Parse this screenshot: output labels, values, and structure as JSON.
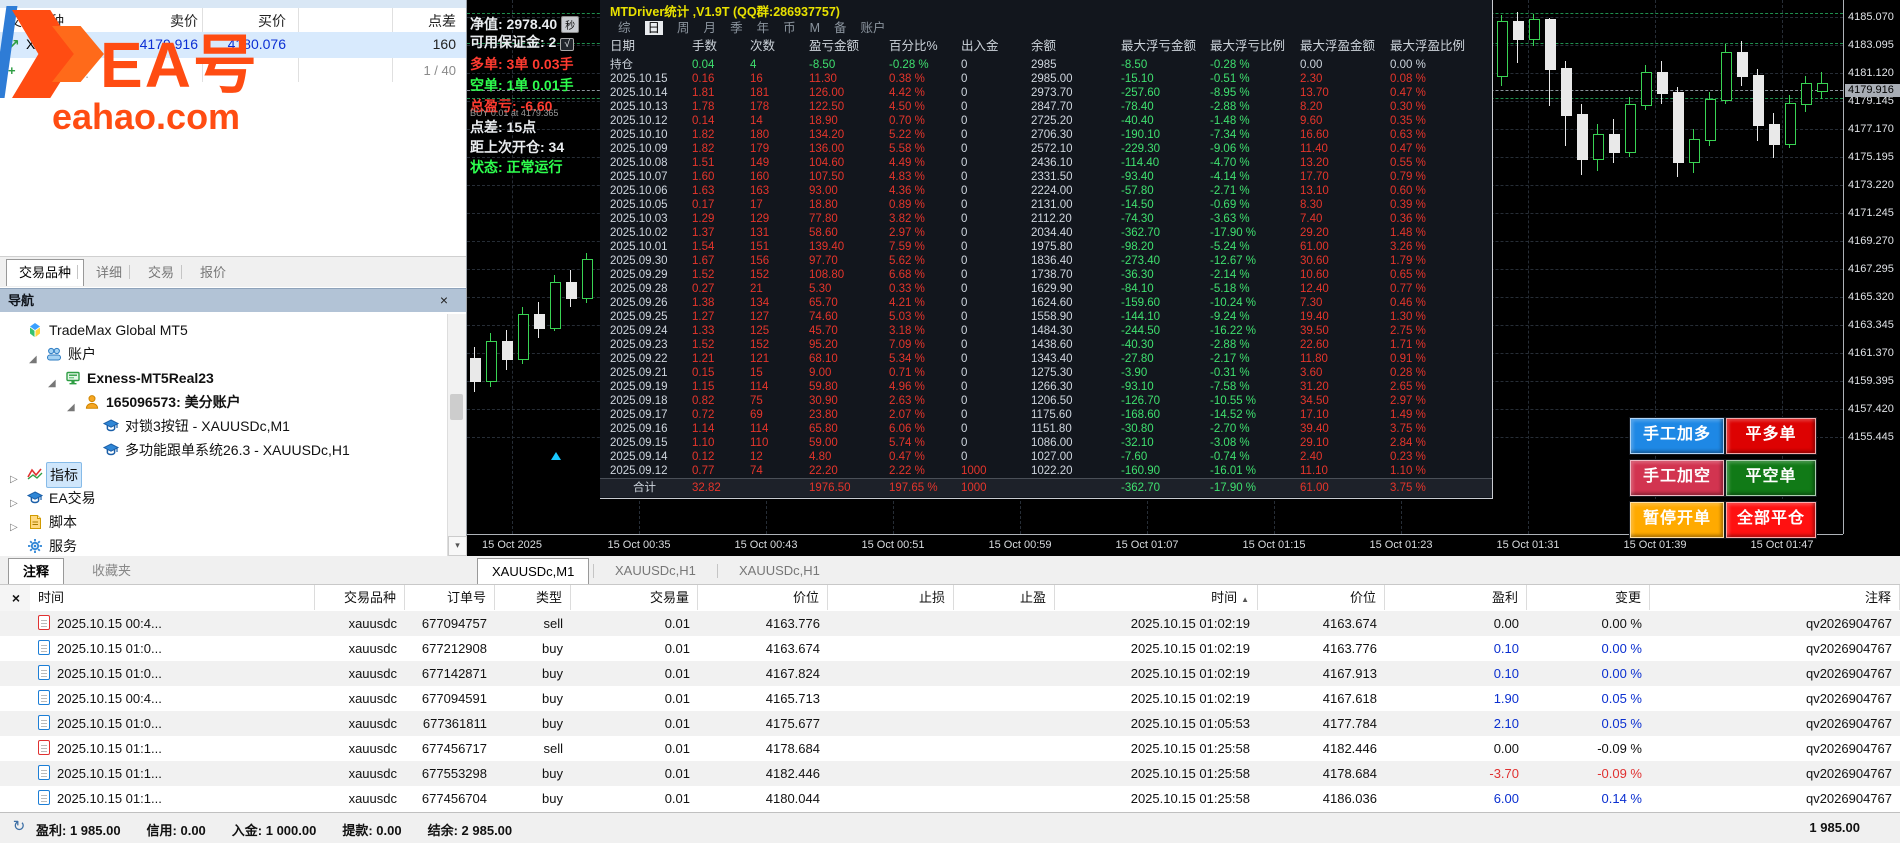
{
  "market_watch": {
    "columns": [
      "交易品种",
      "卖价",
      "买价",
      "点差"
    ],
    "row": {
      "symbol": "XAUUSDc",
      "bid": "4179.916",
      "ask": "4180.076",
      "spread": "160"
    },
    "add_label": "点击添加...",
    "pager": "1 / 40",
    "panel_tabs": [
      "交易品种",
      "详细",
      "交易",
      "报价"
    ],
    "active_panel_tab": "交易品种"
  },
  "watermark": {
    "brand": "EA号",
    "site": "eahao.com",
    "color": "#ff4c12"
  },
  "navigator": {
    "title": "导航",
    "close_glyph": "×",
    "items": [
      {
        "label": "TradeMax Global MT5",
        "icon": "broker-logo-icon",
        "indent": 0,
        "state": "none",
        "bold": false,
        "selected": false
      },
      {
        "label": "账户",
        "icon": "accounts-icon",
        "indent": 1,
        "state": "open",
        "bold": false,
        "selected": false
      },
      {
        "label": "Exness-MT5Real23",
        "icon": "server-icon",
        "indent": 2,
        "state": "open",
        "bold": true,
        "selected": false
      },
      {
        "label": "165096573: 美分账户",
        "icon": "person-icon",
        "indent": 3,
        "state": "open",
        "bold": true,
        "selected": false
      },
      {
        "label": "对锁3按钮 - XAUUSDc,M1",
        "icon": "ea-cap-icon",
        "indent": 4,
        "state": "none",
        "bold": false,
        "selected": false
      },
      {
        "label": "多功能跟单系统26.3 - XAUUSDc,H1",
        "icon": "ea-cap-icon",
        "indent": 4,
        "state": "none",
        "bold": false,
        "selected": false
      },
      {
        "label": "指标",
        "icon": "indicator-icon",
        "indent": 0,
        "state": "closed",
        "bold": false,
        "selected": true
      },
      {
        "label": "EA交易",
        "icon": "ea-cap-icon",
        "indent": 0,
        "state": "closed",
        "bold": false,
        "selected": false
      },
      {
        "label": "脚本",
        "icon": "script-icon",
        "indent": 0,
        "state": "closed",
        "bold": false,
        "selected": false
      },
      {
        "label": "服务",
        "icon": "service-gear-icon",
        "indent": 0,
        "state": "none",
        "bold": false,
        "selected": false
      }
    ],
    "bottom_tabs": [
      "注释",
      "收藏夹"
    ],
    "active_bottom_tab": "注释"
  },
  "chart_info": {
    "lines": [
      {
        "text": "净值: 2978.40",
        "color": "white",
        "badge": "秒",
        "small": false
      },
      {
        "text": "可用保证金: 2",
        "color": "white",
        "badge": "√",
        "small": false
      },
      {
        "text": "多单: 3单 0.03手",
        "color": "red",
        "badge": "",
        "small": false
      },
      {
        "text": "空单: 1单 0.01手",
        "color": "green",
        "badge": "",
        "small": false
      },
      {
        "text": "总盈亏: -6.60",
        "color": "red",
        "badge": "",
        "small": false
      },
      {
        "text": "BUY 0.01 at 4179.365",
        "color": "gray",
        "badge": "",
        "small": true
      },
      {
        "text": "点差: 15点",
        "color": "white",
        "badge": "",
        "small": false
      },
      {
        "text": "距上次开仓: 34",
        "color": "white",
        "badge": "",
        "small": false
      },
      {
        "text": "状态: 正常运行",
        "color": "green",
        "badge": "",
        "small": false
      }
    ]
  },
  "stats_panel": {
    "title": "MTDriver统计 ,V1.9T (QQ群:286937757)",
    "menu": [
      "综",
      "日",
      "周",
      "月",
      "季",
      "年",
      "币",
      "M",
      "备",
      "账户"
    ],
    "active_menu": "日",
    "columns": [
      "日期",
      "手数",
      "次数",
      "盈亏金额",
      "百分比%",
      "出入金",
      "余额",
      "最大浮亏金额",
      "最大浮亏比例",
      "最大浮盈金额",
      "最大浮盈比例"
    ],
    "open_row": [
      "持仓",
      "0.04",
      "4",
      "-8.50",
      "-0.28 %",
      "0",
      "2985",
      "-8.50",
      "-0.28 %",
      "0.00",
      "0.00 %"
    ],
    "rows": [
      [
        "2025.10.15",
        "0.16",
        "16",
        "11.30",
        "0.38 %",
        "0",
        "2985.00",
        "-15.10",
        "-0.51 %",
        "2.30",
        "0.08 %"
      ],
      [
        "2025.10.14",
        "1.81",
        "181",
        "126.00",
        "4.42 %",
        "0",
        "2973.70",
        "-257.60",
        "-8.95 %",
        "13.70",
        "0.47 %"
      ],
      [
        "2025.10.13",
        "1.78",
        "178",
        "122.50",
        "4.50 %",
        "0",
        "2847.70",
        "-78.40",
        "-2.88 %",
        "8.20",
        "0.30 %"
      ],
      [
        "2025.10.12",
        "0.14",
        "14",
        "18.90",
        "0.70 %",
        "0",
        "2725.20",
        "-40.40",
        "-1.48 %",
        "9.60",
        "0.35 %"
      ],
      [
        "2025.10.10",
        "1.82",
        "180",
        "134.20",
        "5.22 %",
        "0",
        "2706.30",
        "-190.10",
        "-7.34 %",
        "16.60",
        "0.63 %"
      ],
      [
        "2025.10.09",
        "1.82",
        "179",
        "136.00",
        "5.58 %",
        "0",
        "2572.10",
        "-229.30",
        "-9.06 %",
        "11.40",
        "0.47 %"
      ],
      [
        "2025.10.08",
        "1.51",
        "149",
        "104.60",
        "4.49 %",
        "0",
        "2436.10",
        "-114.40",
        "-4.70 %",
        "13.20",
        "0.55 %"
      ],
      [
        "2025.10.07",
        "1.60",
        "160",
        "107.50",
        "4.83 %",
        "0",
        "2331.50",
        "-93.40",
        "-4.14 %",
        "17.70",
        "0.79 %"
      ],
      [
        "2025.10.06",
        "1.63",
        "163",
        "93.00",
        "4.36 %",
        "0",
        "2224.00",
        "-57.80",
        "-2.71 %",
        "13.10",
        "0.60 %"
      ],
      [
        "2025.10.05",
        "0.17",
        "17",
        "18.80",
        "0.89 %",
        "0",
        "2131.00",
        "-14.50",
        "-0.69 %",
        "8.30",
        "0.39 %"
      ],
      [
        "2025.10.03",
        "1.29",
        "129",
        "77.80",
        "3.82 %",
        "0",
        "2112.20",
        "-74.30",
        "-3.63 %",
        "7.40",
        "0.36 %"
      ],
      [
        "2025.10.02",
        "1.37",
        "131",
        "58.60",
        "2.97 %",
        "0",
        "2034.40",
        "-362.70",
        "-17.90 %",
        "29.20",
        "1.48 %"
      ],
      [
        "2025.10.01",
        "1.54",
        "151",
        "139.40",
        "7.59 %",
        "0",
        "1975.80",
        "-98.20",
        "-5.24 %",
        "61.00",
        "3.26 %"
      ],
      [
        "2025.09.30",
        "1.67",
        "156",
        "97.70",
        "5.62 %",
        "0",
        "1836.40",
        "-273.40",
        "-12.67 %",
        "30.60",
        "1.79 %"
      ],
      [
        "2025.09.29",
        "1.52",
        "152",
        "108.80",
        "6.68 %",
        "0",
        "1738.70",
        "-36.30",
        "-2.14 %",
        "10.60",
        "0.65 %"
      ],
      [
        "2025.09.28",
        "0.27",
        "21",
        "5.30",
        "0.33 %",
        "0",
        "1629.90",
        "-84.10",
        "-5.18 %",
        "12.40",
        "0.77 %"
      ],
      [
        "2025.09.26",
        "1.38",
        "134",
        "65.70",
        "4.21 %",
        "0",
        "1624.60",
        "-159.60",
        "-10.24 %",
        "7.30",
        "0.46 %"
      ],
      [
        "2025.09.25",
        "1.27",
        "127",
        "74.60",
        "5.03 %",
        "0",
        "1558.90",
        "-144.10",
        "-9.24 %",
        "19.40",
        "1.30 %"
      ],
      [
        "2025.09.24",
        "1.33",
        "125",
        "45.70",
        "3.18 %",
        "0",
        "1484.30",
        "-244.50",
        "-16.22 %",
        "39.50",
        "2.75 %"
      ],
      [
        "2025.09.23",
        "1.52",
        "152",
        "95.20",
        "7.09 %",
        "0",
        "1438.60",
        "-40.30",
        "-2.88 %",
        "22.60",
        "1.71 %"
      ],
      [
        "2025.09.22",
        "1.21",
        "121",
        "68.10",
        "5.34 %",
        "0",
        "1343.40",
        "-27.80",
        "-2.17 %",
        "11.80",
        "0.91 %"
      ],
      [
        "2025.09.21",
        "0.15",
        "15",
        "9.00",
        "0.71 %",
        "0",
        "1275.30",
        "-3.90",
        "-0.31 %",
        "3.60",
        "0.28 %"
      ],
      [
        "2025.09.19",
        "1.15",
        "114",
        "59.80",
        "4.96 %",
        "0",
        "1266.30",
        "-93.10",
        "-7.58 %",
        "31.20",
        "2.65 %"
      ],
      [
        "2025.09.18",
        "0.82",
        "75",
        "30.90",
        "2.63 %",
        "0",
        "1206.50",
        "-126.70",
        "-10.55 %",
        "34.50",
        "2.97 %"
      ],
      [
        "2025.09.17",
        "0.72",
        "69",
        "23.80",
        "2.07 %",
        "0",
        "1175.60",
        "-168.60",
        "-14.52 %",
        "17.10",
        "1.49 %"
      ],
      [
        "2025.09.16",
        "1.14",
        "114",
        "65.80",
        "6.06 %",
        "0",
        "1151.80",
        "-30.80",
        "-2.70 %",
        "39.40",
        "3.75 %"
      ],
      [
        "2025.09.15",
        "1.10",
        "110",
        "59.00",
        "5.74 %",
        "0",
        "1086.00",
        "-32.10",
        "-3.08 %",
        "29.10",
        "2.84 %"
      ],
      [
        "2025.09.14",
        "0.12",
        "12",
        "4.80",
        "0.47 %",
        "0",
        "1027.00",
        "-7.60",
        "-0.74 %",
        "2.40",
        "0.23 %"
      ],
      [
        "2025.09.12",
        "0.77",
        "74",
        "22.20",
        "2.22 %",
        "1000",
        "1022.20",
        "-160.90",
        "-16.01 %",
        "11.10",
        "1.10 %"
      ]
    ],
    "total_row": [
      "合计",
      "32.82",
      "",
      "1976.50",
      "197.65 %",
      "1000",
      "",
      "-362.70",
      "-17.90 %",
      "61.00",
      "3.75 %"
    ]
  },
  "chart": {
    "price_ticks": [
      "4185.070",
      "4183.095",
      "4181.120",
      "4179.145",
      "4177.170",
      "4175.195",
      "4173.220",
      "4171.245",
      "4169.270",
      "4167.295",
      "4165.320",
      "4163.345",
      "4161.370",
      "4159.395",
      "4157.420",
      "4155.445"
    ],
    "current_price": "4179.916",
    "time_ticks": [
      "15 Oct 2025",
      "15 Oct 00:35",
      "15 Oct 00:43",
      "15 Oct 00:51",
      "15 Oct 00:59",
      "15 Oct 01:07",
      "15 Oct 01:15",
      "15 Oct 01:23",
      "15 Oct 01:31",
      "15 Oct 01:39",
      "15 Oct 01:47"
    ],
    "tabs": [
      "XAUUSDc,M1",
      "XAUUSDc,H1",
      "XAUUSDc,H1"
    ],
    "active_tab_index": 0,
    "candles_right": [
      [
        1497,
        4181.0,
        4184.8,
        4185.2,
        4180.2,
        1
      ],
      [
        1513,
        4184.8,
        4183.6,
        4185.4,
        4181.8,
        0
      ],
      [
        1529,
        4183.6,
        4184.9,
        4185.3,
        4183.0,
        1
      ],
      [
        1545,
        4184.9,
        4181.5,
        4185.0,
        4178.8,
        0
      ],
      [
        1561,
        4181.5,
        4178.2,
        4182.0,
        4176.0,
        0
      ],
      [
        1577,
        4178.2,
        4175.1,
        4178.9,
        4173.9,
        0
      ],
      [
        1593,
        4175.1,
        4176.8,
        4177.5,
        4174.2,
        1
      ],
      [
        1609,
        4176.8,
        4175.6,
        4177.9,
        4174.8,
        0
      ],
      [
        1625,
        4175.6,
        4178.9,
        4179.4,
        4175.2,
        1
      ],
      [
        1641,
        4178.9,
        4181.2,
        4181.7,
        4178.5,
        1
      ],
      [
        1657,
        4181.2,
        4179.8,
        4182.0,
        4178.9,
        0
      ],
      [
        1673,
        4179.8,
        4174.9,
        4180.1,
        4173.8,
        0
      ],
      [
        1689,
        4174.9,
        4176.5,
        4177.2,
        4174.1,
        1
      ],
      [
        1705,
        4176.5,
        4179.3,
        4179.8,
        4176.0,
        1
      ],
      [
        1721,
        4179.3,
        4182.6,
        4183.2,
        4178.9,
        1
      ],
      [
        1737,
        4182.6,
        4181.0,
        4183.4,
        4180.2,
        0
      ],
      [
        1753,
        4181.0,
        4177.5,
        4181.4,
        4176.3,
        0
      ],
      [
        1769,
        4177.5,
        4176.2,
        4178.3,
        4175.1,
        0
      ],
      [
        1785,
        4176.2,
        4179.0,
        4179.6,
        4175.8,
        1
      ],
      [
        1801,
        4179.0,
        4180.4,
        4180.9,
        4178.4,
        1
      ],
      [
        1817,
        4180.4,
        4179.9,
        4181.2,
        4179.3,
        1
      ]
    ],
    "candles_left": [
      [
        470,
        4161.0,
        4159.5,
        4161.8,
        4158.6,
        0
      ],
      [
        486,
        4159.5,
        4162.2,
        4162.8,
        4159.0,
        1
      ],
      [
        502,
        4162.2,
        4161.0,
        4163.0,
        4160.2,
        0
      ],
      [
        518,
        4161.0,
        4164.1,
        4164.6,
        4160.6,
        1
      ],
      [
        534,
        4164.1,
        4163.2,
        4165.0,
        4162.4,
        0
      ],
      [
        550,
        4163.2,
        4166.4,
        4166.9,
        4162.9,
        1
      ],
      [
        566,
        4166.4,
        4165.3,
        4167.2,
        4164.6,
        0
      ],
      [
        582,
        4165.3,
        4168.0,
        4168.4,
        4164.9,
        1
      ]
    ]
  },
  "trade_buttons": [
    {
      "label": "手工加多",
      "bg": "#1e88e5"
    },
    {
      "label": "平多单",
      "bg": "#dd0202"
    },
    {
      "label": "手工加空",
      "bg": "#d23450"
    },
    {
      "label": "平空单",
      "bg": "#117a17"
    },
    {
      "label": "暂停开单",
      "bg": "#ffaa00"
    },
    {
      "label": "全部平仓",
      "bg": "#ff1111"
    }
  ],
  "orders": {
    "columns": [
      "时间",
      "交易品种",
      "订单号",
      "类型",
      "交易量",
      "价位",
      "止损",
      "止盈",
      "时间",
      "价位",
      "盈利",
      "变更",
      "注释"
    ],
    "sorted_column_index": 8,
    "rows": [
      {
        "open_time": "2025.10.15 00:4...",
        "symbol": "xauusdc",
        "order": "677094757",
        "type": "sell",
        "volume": "0.01",
        "price": "4163.776",
        "sl": "",
        "tp": "",
        "close_time": "2025.10.15 01:02:19",
        "close_price": "4163.674",
        "profit": "0.00",
        "profit_color": "black",
        "change": "0.00 %",
        "change_color": "black",
        "comment": "qv2026904767"
      },
      {
        "open_time": "2025.10.15 01:0...",
        "symbol": "xauusdc",
        "order": "677212908",
        "type": "buy",
        "volume": "0.01",
        "price": "4163.674",
        "sl": "",
        "tp": "",
        "close_time": "2025.10.15 01:02:19",
        "close_price": "4163.776",
        "profit": "0.10",
        "profit_color": "blue",
        "change": "0.00 %",
        "change_color": "blue",
        "comment": "qv2026904767"
      },
      {
        "open_time": "2025.10.15 01:0...",
        "symbol": "xauusdc",
        "order": "677142871",
        "type": "buy",
        "volume": "0.01",
        "price": "4167.824",
        "sl": "",
        "tp": "",
        "close_time": "2025.10.15 01:02:19",
        "close_price": "4167.913",
        "profit": "0.10",
        "profit_color": "blue",
        "change": "0.00 %",
        "change_color": "blue",
        "comment": "qv2026904767"
      },
      {
        "open_time": "2025.10.15 00:4...",
        "symbol": "xauusdc",
        "order": "677094591",
        "type": "buy",
        "volume": "0.01",
        "price": "4165.713",
        "sl": "",
        "tp": "",
        "close_time": "2025.10.15 01:02:19",
        "close_price": "4167.618",
        "profit": "1.90",
        "profit_color": "blue",
        "change": "0.05 %",
        "change_color": "blue",
        "comment": "qv2026904767"
      },
      {
        "open_time": "2025.10.15 01:0...",
        "symbol": "xauusdc",
        "order": "677361811",
        "type": "buy",
        "volume": "0.01",
        "price": "4175.677",
        "sl": "",
        "tp": "",
        "close_time": "2025.10.15 01:05:53",
        "close_price": "4177.784",
        "profit": "2.10",
        "profit_color": "blue",
        "change": "0.05 %",
        "change_color": "blue",
        "comment": "qv2026904767"
      },
      {
        "open_time": "2025.10.15 01:1...",
        "symbol": "xauusdc",
        "order": "677456717",
        "type": "sell",
        "volume": "0.01",
        "price": "4178.684",
        "sl": "",
        "tp": "",
        "close_time": "2025.10.15 01:25:58",
        "close_price": "4182.446",
        "profit": "0.00",
        "profit_color": "black",
        "change": "-0.09 %",
        "change_color": "black",
        "comment": "qv2026904767"
      },
      {
        "open_time": "2025.10.15 01:1...",
        "symbol": "xauusdc",
        "order": "677553298",
        "type": "buy",
        "volume": "0.01",
        "price": "4182.446",
        "sl": "",
        "tp": "",
        "close_time": "2025.10.15 01:25:58",
        "close_price": "4178.684",
        "profit": "-3.70",
        "profit_color": "red",
        "change": "-0.09 %",
        "change_color": "red",
        "comment": "qv2026904767"
      },
      {
        "open_time": "2025.10.15 01:1...",
        "symbol": "xauusdc",
        "order": "677456704",
        "type": "buy",
        "volume": "0.01",
        "price": "4180.044",
        "sl": "",
        "tp": "",
        "close_time": "2025.10.15 01:25:58",
        "close_price": "4186.036",
        "profit": "6.00",
        "profit_color": "blue",
        "change": "0.14 %",
        "change_color": "blue",
        "comment": "qv2026904767"
      }
    ]
  },
  "status_bar": {
    "items": [
      "盈利: 1 985.00",
      "信用: 0.00",
      "入金: 1 000.00",
      "提款: 0.00",
      "结余: 2 985.00"
    ],
    "total": "1 985.00"
  }
}
